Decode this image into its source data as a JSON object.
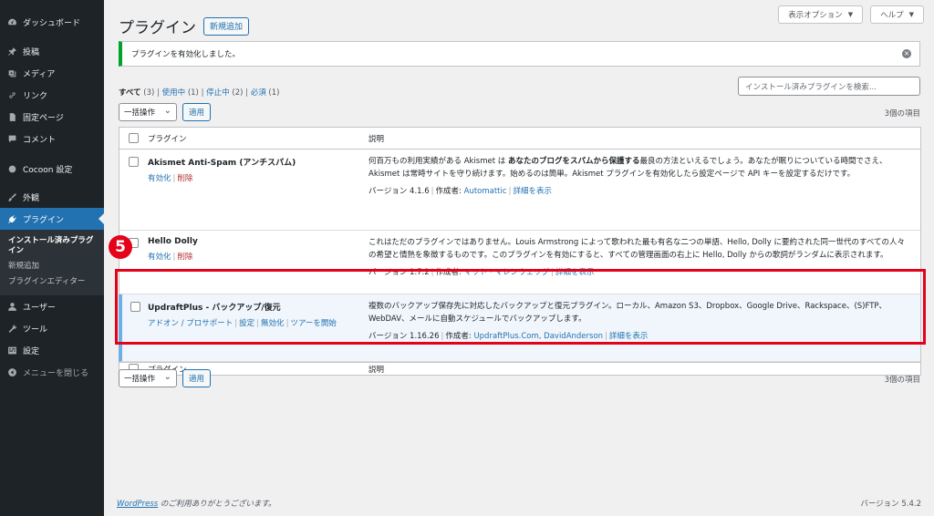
{
  "sidebar": {
    "items": [
      {
        "label": "ダッシュボード",
        "icon": "dashboard-icon"
      },
      {
        "label": "投稿",
        "icon": "pin-icon"
      },
      {
        "label": "メディア",
        "icon": "media-icon"
      },
      {
        "label": "リンク",
        "icon": "link-icon"
      },
      {
        "label": "固定ページ",
        "icon": "page-icon"
      },
      {
        "label": "コメント",
        "icon": "comment-icon"
      },
      {
        "label": "Cocoon 設定",
        "icon": "cocoon-icon"
      },
      {
        "label": "外観",
        "icon": "brush-icon"
      },
      {
        "label": "プラグイン",
        "icon": "plugin-icon"
      },
      {
        "label": "ユーザー",
        "icon": "user-icon"
      },
      {
        "label": "ツール",
        "icon": "wrench-icon"
      },
      {
        "label": "設定",
        "icon": "settings-icon"
      },
      {
        "label": "メニューを閉じる",
        "icon": "collapse-icon"
      }
    ],
    "submenu": {
      "installed": "インストール済みプラグイン",
      "add_new": "新規追加",
      "editor": "プラグインエディター"
    }
  },
  "header": {
    "screen_options": "表示オプション",
    "help": "ヘルプ",
    "title": "プラグイン",
    "add_new": "新規追加"
  },
  "notice": {
    "text": "プラグインを有効化しました。"
  },
  "filters": {
    "all": "すべて",
    "all_count": "(3)",
    "active": "使用中",
    "active_count": "(1)",
    "inactive": "停止中",
    "inactive_count": "(2)",
    "required": "必須",
    "required_count": "(1)",
    "sep": "|"
  },
  "search": {
    "placeholder": "インストール済みプラグインを検索..."
  },
  "bulk": {
    "select": "一括操作",
    "apply": "適用"
  },
  "items_count": "3個の項目",
  "table": {
    "col_plugin": "プラグイン",
    "col_desc": "説明",
    "rows": [
      {
        "name": "Akismet Anti-Spam (アンチスパム)",
        "action1": "有効化",
        "action2": "削除",
        "desc_pre": "何百万もの利用実績がある Akismet は",
        "desc_bold": "あなたのブログをスパムから保護する",
        "desc_post": "最良の方法といえるでしょう。あなたが眠りについている時間でさえ、Akismet は常時サイトを守り続けます。始めるのは簡単。Akismet プラグインを有効化したら設定ページで API キーを設定するだけです。",
        "version": "バージョン 4.1.6",
        "author_label": "作成者:",
        "author": "Automattic",
        "details": "詳細を表示"
      },
      {
        "name": "Hello Dolly",
        "action1": "有効化",
        "action2": "削除",
        "desc": "これはただのプラグインではありません。Louis Armstrong によって歌われた最も有名な二つの単語、Hello, Dolly に要約された同一世代のすべての人々の希望と情熱を象徴するものです。このプラグインを有効にすると、すべての管理画面の右上に Hello, Dolly からの歌詞がランダムに表示されます。",
        "version": "バージョン 1.7.2",
        "author_label": "作成者:",
        "author": "マット・マレンウェッグ",
        "details": "詳細を表示"
      },
      {
        "name": "UpdraftPlus - バックアップ/復元",
        "action1": "アドオン / プロサポート",
        "action2": "設定",
        "action3": "無効化",
        "action4": "ツアーを開始",
        "desc": "複数のバックアップ保存先に対応したバックアップと復元プラグイン。ローカル、Amazon S3、Dropbox、Google Drive、Rackspace、(S)FTP、WebDAV、メールに自動スケジュールでバックアップします。",
        "version": "バージョン 1.16.26",
        "author_label": "作成者:",
        "author": "UpdraftPlus.Com, DavidAnderson",
        "details": "詳細を表示"
      }
    ]
  },
  "annotation": {
    "step": "5",
    "color": "#e4021b"
  },
  "footer": {
    "link": "WordPress",
    "text": " のご利用ありがとうございます。",
    "version": "バージョン 5.4.2"
  }
}
